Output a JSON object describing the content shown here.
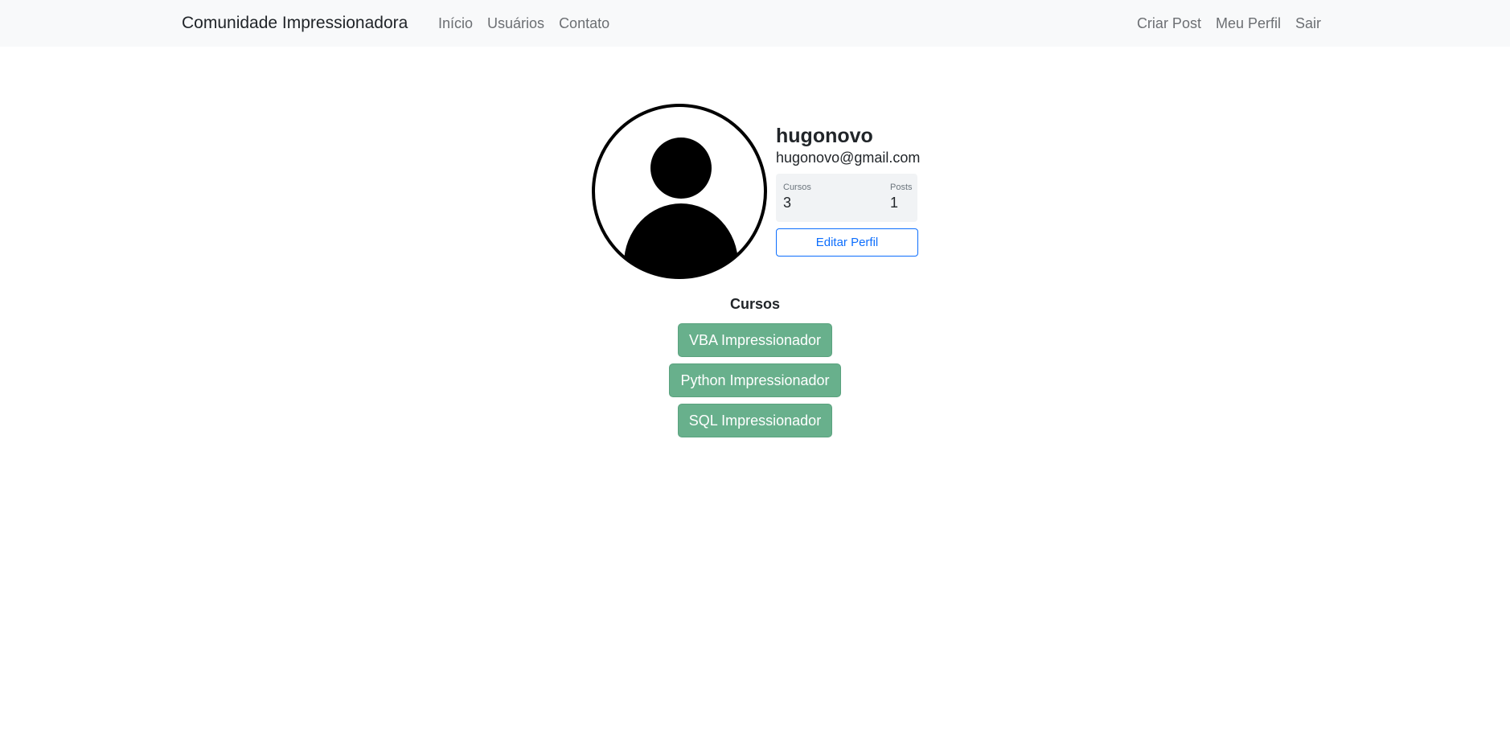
{
  "navbar": {
    "brand": "Comunidade Impressionadora",
    "left_links": [
      "Início",
      "Usuários",
      "Contato"
    ],
    "right_links": [
      "Criar Post",
      "Meu Perfil",
      "Sair"
    ]
  },
  "profile": {
    "avatar_icon": "user-avatar-icon",
    "username": "hugonovo",
    "email": "hugonovo@gmail.com",
    "stats": {
      "cursos_label": "Cursos",
      "cursos_value": "3",
      "posts_label": "Posts",
      "posts_value": "1"
    },
    "edit_button": "Editar Perfil"
  },
  "courses": {
    "title": "Cursos",
    "items": [
      "VBA Impressionador",
      "Python Impressionador",
      "SQL Impressionador"
    ]
  },
  "colors": {
    "navbar_bg": "#f8f9fa",
    "primary": "#0d6efd",
    "course_button": "#68b08c"
  }
}
